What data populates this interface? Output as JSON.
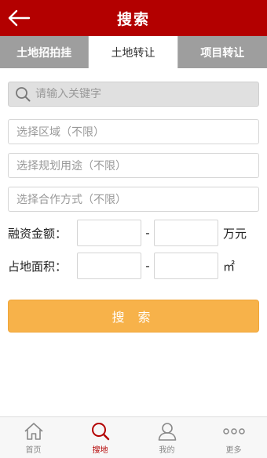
{
  "header": {
    "title": "搜索"
  },
  "tabs": [
    {
      "label": "土地招拍挂",
      "active": false
    },
    {
      "label": "土地转让",
      "active": true
    },
    {
      "label": "项目转让",
      "active": false
    }
  ],
  "search": {
    "placeholder": "请输入关键字"
  },
  "filters": {
    "region": "选择区域（不限）",
    "usage": "选择规划用途（不限）",
    "cooperation": "选择合作方式（不限）"
  },
  "financing": {
    "label": "融资金额：",
    "dash": "-",
    "unit": "万元"
  },
  "area": {
    "label": "占地面积：",
    "dash": "-",
    "unit": "㎡"
  },
  "submit": {
    "label": "搜 索"
  },
  "bottom_nav": [
    {
      "label": "首页",
      "icon": "home-icon",
      "active": false
    },
    {
      "label": "搜地",
      "icon": "search-icon",
      "active": true
    },
    {
      "label": "我的",
      "icon": "user-icon",
      "active": false
    },
    {
      "label": "更多",
      "icon": "more-icon",
      "active": false
    }
  ],
  "colors": {
    "header": "#b30000",
    "tab_bar": "#9e9e9e",
    "accent": "#f7b24a",
    "nav_active": "#b30000"
  }
}
